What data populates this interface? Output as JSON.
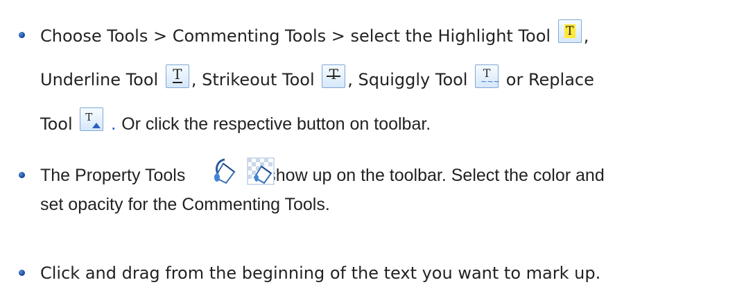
{
  "bullets": {
    "b1": {
      "line1_pre": "Choose Tools > Commenting Tools > select the Highlight Tool",
      "line1_post": ",",
      "line2_a": "Underline Tool",
      "line2_b": ", Strikeout Tool",
      "line2_c": ", Squiggly Tool",
      "line2_d": "or Replace",
      "line3_a": "Tool",
      "line3_dot": ".",
      "line3_b": "Or click the respective button on toolbar."
    },
    "b2": {
      "line1_pre": "The Property Tools",
      "line1_post": "show up on the toolbar. Select the color and",
      "line2": "set opacity for the Commenting Tools."
    },
    "b3": {
      "line1": "Click and drag from the beginning of the text you want to mark up."
    }
  },
  "icons": {
    "highlight": "highlight-tool-icon",
    "underline": "underline-tool-icon",
    "strikeout": "strikeout-tool-icon",
    "squiggly": "squiggly-tool-icon",
    "replace": "replace-tool-icon",
    "property_color": "paint-bucket-color-icon",
    "property_opacity": "paint-bucket-opacity-icon",
    "glyph": "T",
    "squiggle_glyph": "~~~"
  },
  "colors": {
    "bullet": "#1b4fa8",
    "text": "#222222",
    "highlight": "#ffe93a",
    "accent_blue": "#1a5fd0"
  }
}
